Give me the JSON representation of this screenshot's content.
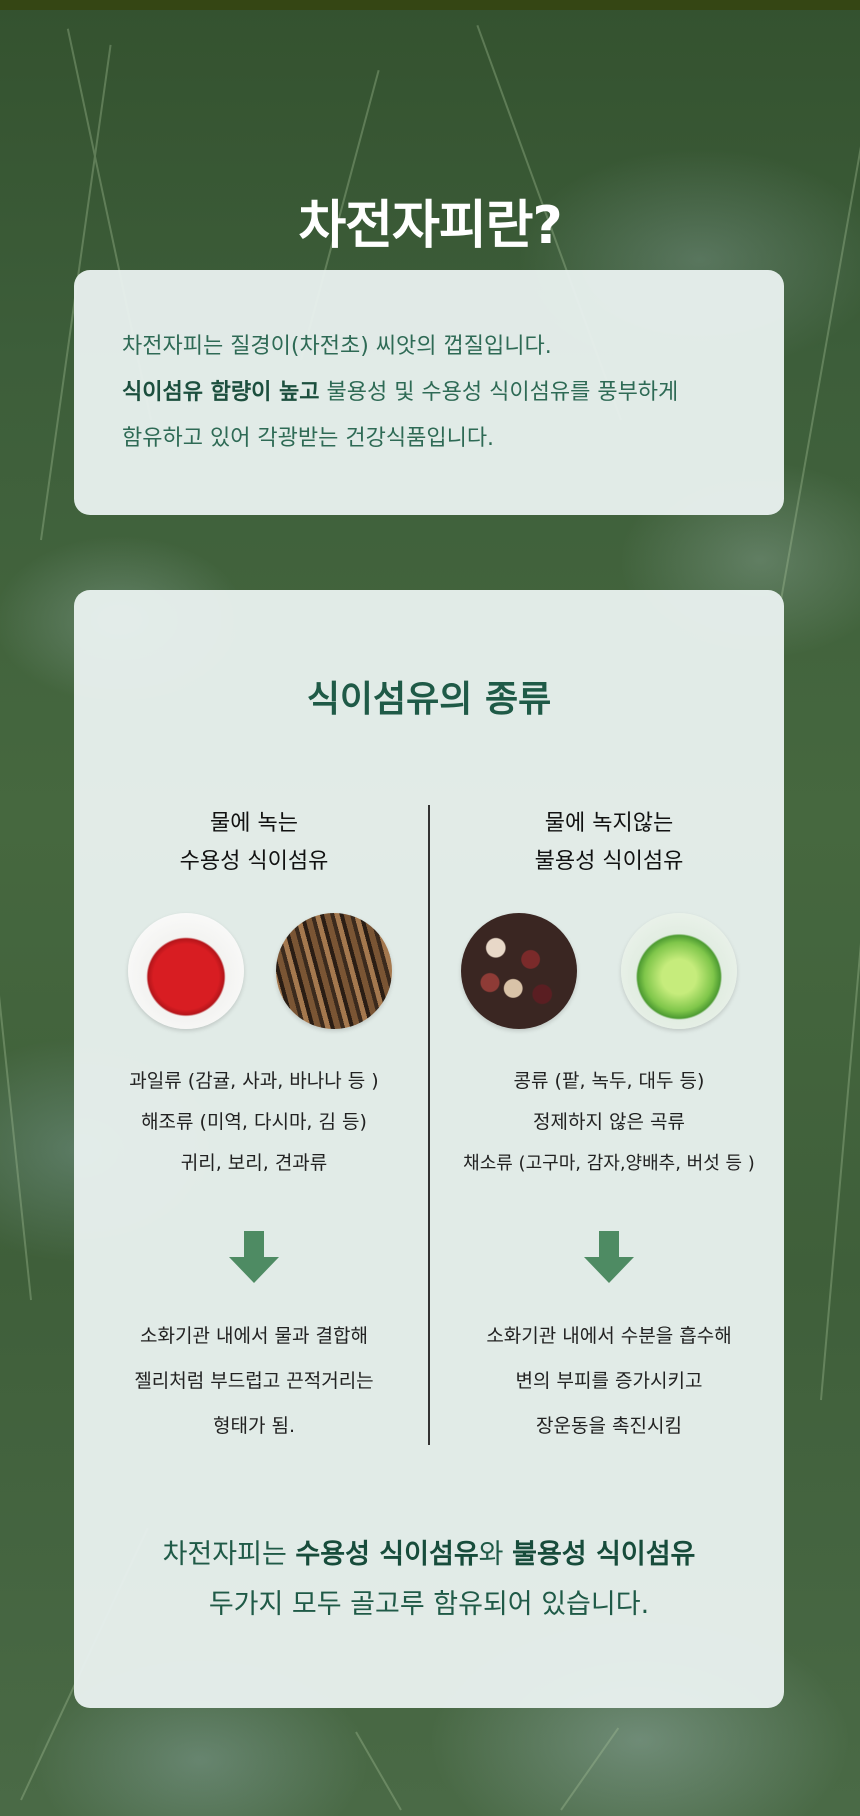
{
  "header": {
    "title": "차전자피란?"
  },
  "intro": {
    "line1": "차전자피는 질경이(차전초) 씨앗의 껍질입니다.",
    "line2_bold": "식이섬유 함량이 높고",
    "line2_rest": " 불용성 및 수용성 식이섬유를 풍부하게",
    "line3": "함유하고 있어 각광받는 건강식품입니다."
  },
  "fiber_types": {
    "title": "식이섬유의 종류",
    "soluble": {
      "heading_line1": "물에 녹는",
      "heading_line2": "수용성 식이섬유",
      "photos": [
        "apple-photo",
        "oat-photo"
      ],
      "examples": [
        "과일류 (감귤, 사과, 바나나 등 )",
        "해조류 (미역, 다시마, 김 등)",
        "귀리, 보리, 견과류"
      ],
      "effect": [
        "소화기관 내에서 물과 결합해",
        "젤리처럼 부드럽고 끈적거리는",
        "형태가 됨."
      ]
    },
    "insoluble": {
      "heading_line1": "물에 녹지않는",
      "heading_line2": "불용성 식이섬유",
      "photos": [
        "beans-photo",
        "cabbage-photo"
      ],
      "examples": [
        "콩류 (팥, 녹두, 대두 등)",
        "정제하지 않은 곡류",
        "채소류 (고구마, 감자,양배추, 버섯 등 )"
      ],
      "effect": [
        "소화기관 내에서 수분을 흡수해",
        "변의 부피를 증가시키고",
        "장운동을 촉진시킴"
      ]
    }
  },
  "summary": {
    "pre": "차전자피는 ",
    "bold1": "수용성 식이섬유",
    "mid": "와 ",
    "bold2": "불용성 식이섬유",
    "line2": "두가지 모두 골고루 함유되어 있습니다."
  },
  "colors": {
    "accent": "#1f5a47",
    "arrow": "#4e8b63",
    "card": "#e8f0ee"
  }
}
